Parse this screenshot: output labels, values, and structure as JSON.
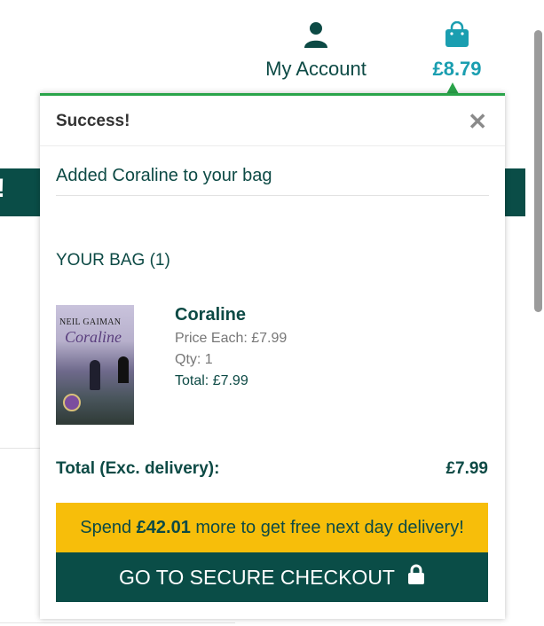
{
  "header": {
    "account_label": "My Account",
    "account_icon": "user-icon",
    "bag_amount": "£8.79",
    "bag_icon": "shopping-bag-icon"
  },
  "popup": {
    "status": "Success!",
    "close_icon": "close-icon",
    "message": "Added Coraline to your bag",
    "bag_heading": "YOUR BAG (1)",
    "item": {
      "name": "Coraline",
      "price_each": "Price Each: £7.99",
      "qty": "Qty: 1",
      "total": "Total: £7.99",
      "cover_author": "NEIL GAIMAN",
      "cover_title": "Coraline"
    },
    "totals_label": "Total (Exc. delivery):",
    "totals_value": "£7.99",
    "promo_prefix": "Spend",
    "promo_amount": "£42.01",
    "promo_suffix": "more to get free next day delivery!",
    "checkout_label": "GO TO SECURE CHECKOUT",
    "checkout_icon": "lock-icon"
  },
  "colors": {
    "brand_green": "#0a4d47",
    "accent_green": "#2aa44a",
    "bag_blue": "#1a9eb0",
    "promo_yellow": "#f7be0a"
  }
}
